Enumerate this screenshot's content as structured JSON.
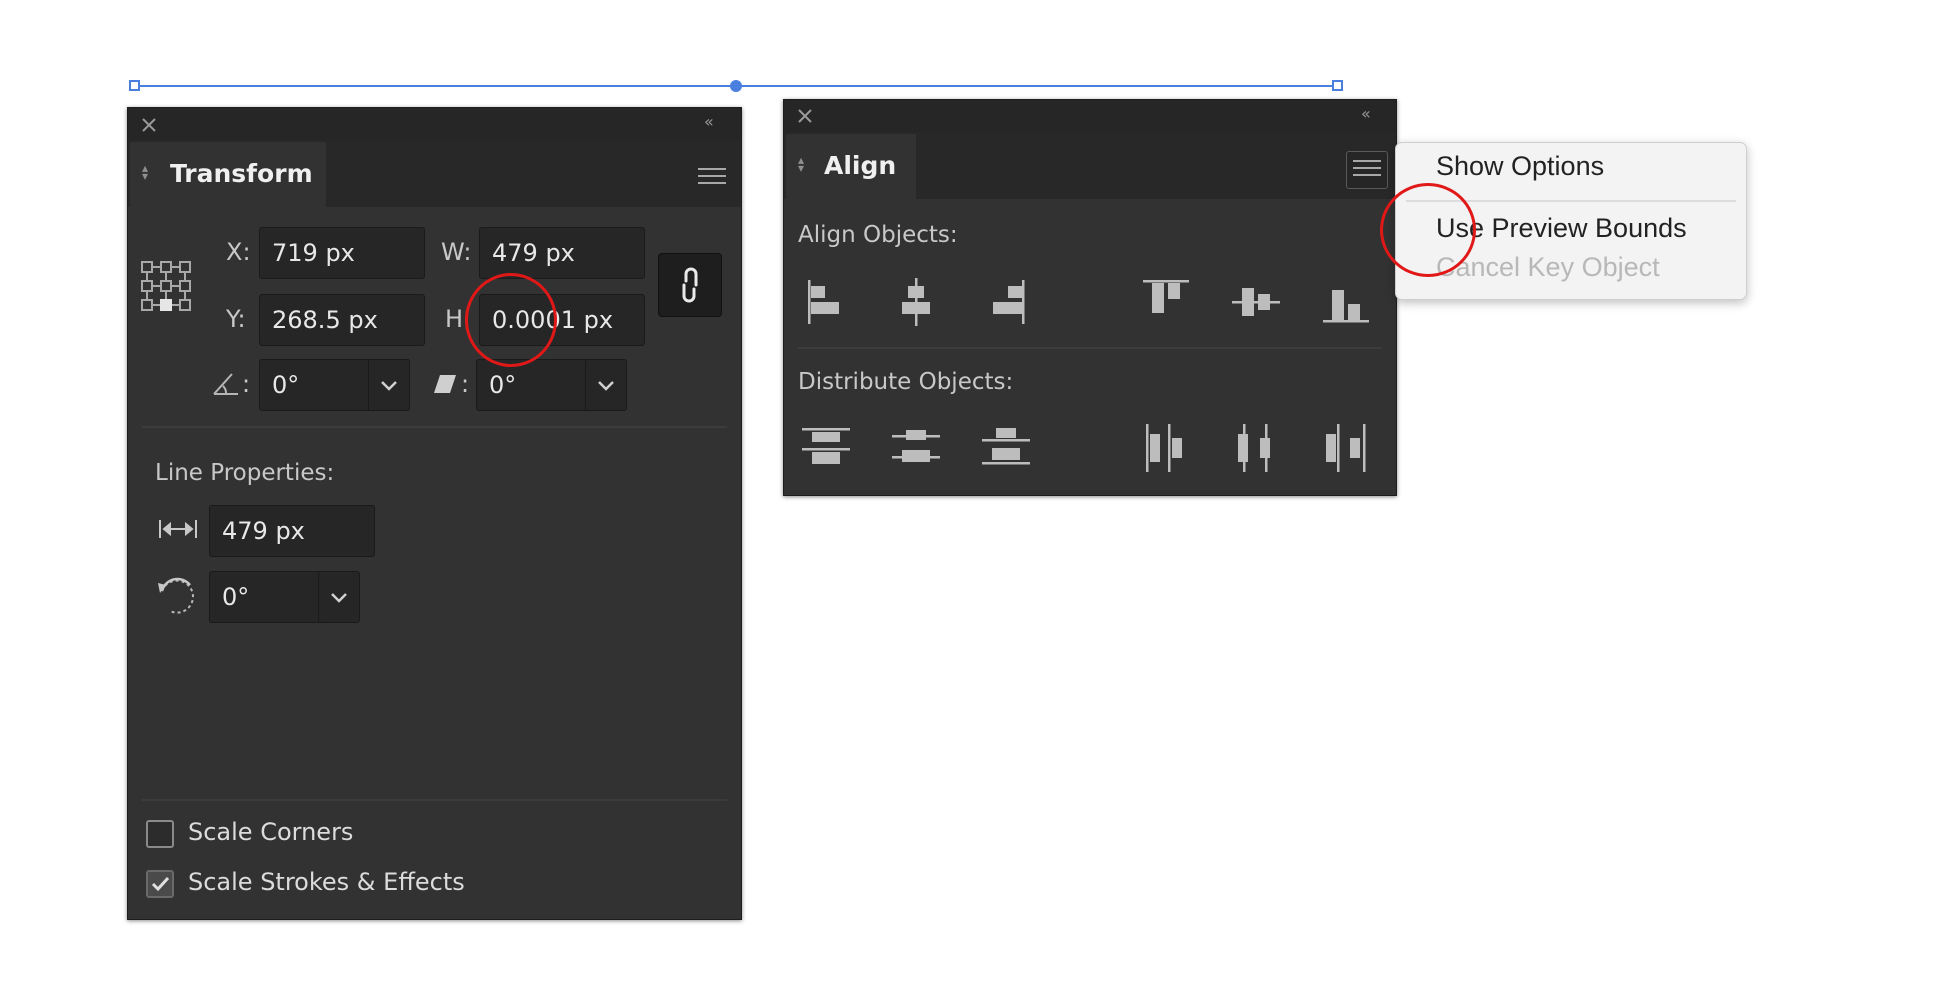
{
  "transform_panel": {
    "tab_title": "Transform",
    "x_label": "X:",
    "x_value": "719 px",
    "y_label": "Y:",
    "y_value": "268.5 px",
    "w_label": "W:",
    "w_value": "479 px",
    "h_label": "H",
    "h_value": "0.0001 px",
    "rotate_colon": ":",
    "rotate_value": "0°",
    "shear_colon": ":",
    "shear_value": "0°",
    "line_properties_title": "Line Properties:",
    "line_length_value": "479 px",
    "line_angle_value": "0°",
    "scale_corners_label": "Scale Corners",
    "scale_corners_checked": false,
    "scale_strokes_label": "Scale Strokes & Effects",
    "scale_strokes_checked": true
  },
  "align_panel": {
    "tab_title": "Align",
    "align_objects_title": "Align Objects:",
    "distribute_objects_title": "Distribute Objects:"
  },
  "menu": {
    "items": [
      {
        "label": "Show Options",
        "enabled": true
      },
      {
        "label": "Use Preview Bounds",
        "enabled": true
      },
      {
        "label": "Cancel Key Object",
        "enabled": false
      }
    ]
  },
  "colors": {
    "panel_bg": "#323232",
    "panel_header": "#262626",
    "selection": "#4a7fe0",
    "annotation": "#e01818"
  }
}
